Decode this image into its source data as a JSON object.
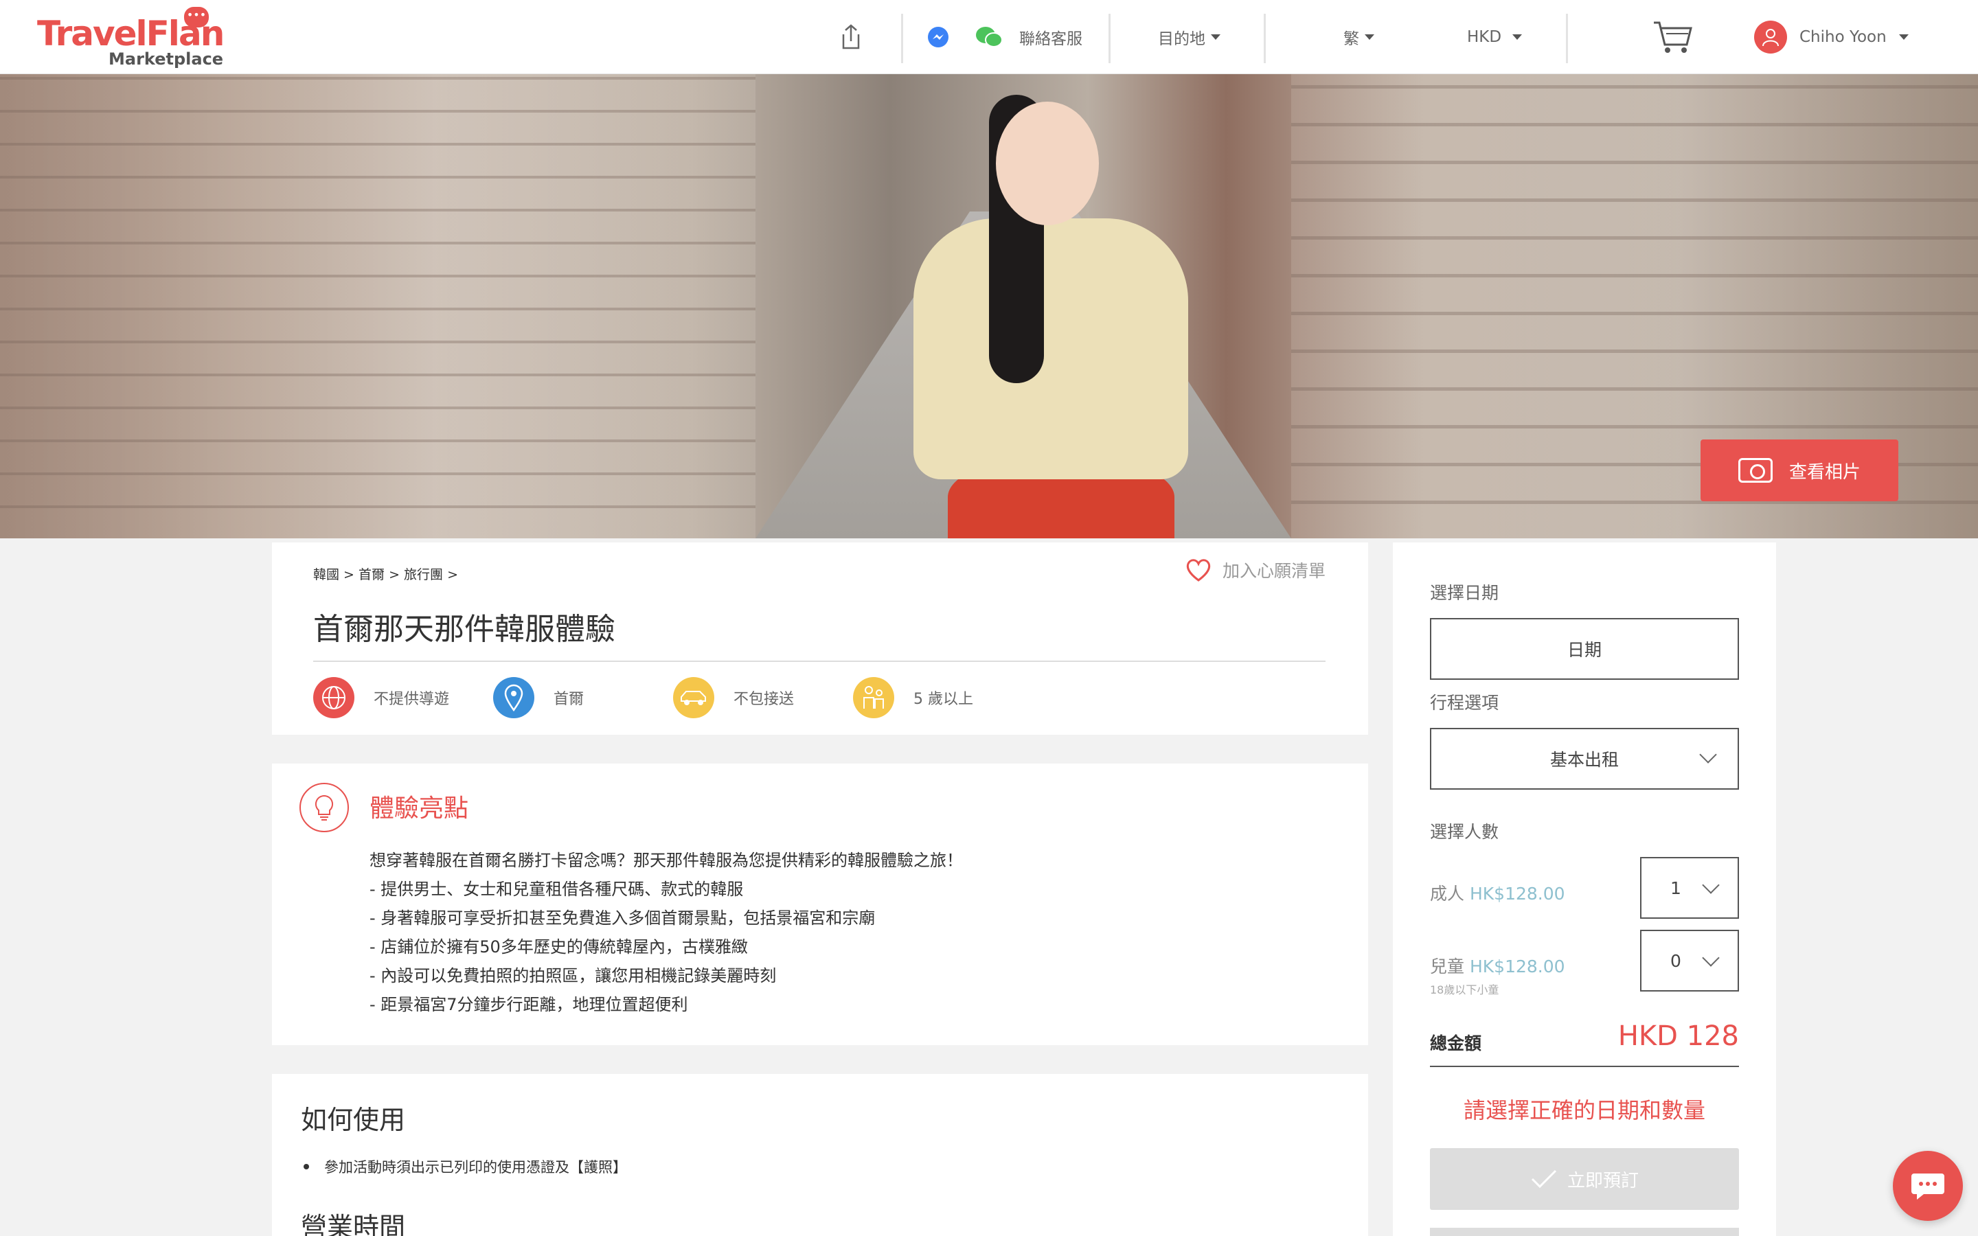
{
  "brand": {
    "name": "TravelFlan",
    "sub": "Marketplace"
  },
  "header": {
    "contact": "聯絡客服",
    "destination": "目的地",
    "language": "繁",
    "currency": "HKD",
    "user": "Chiho Yoon"
  },
  "hero": {
    "photos_button": "查看相片"
  },
  "product": {
    "breadcrumb": [
      "韓國",
      "首爾",
      "旅行團"
    ],
    "wishlist": "加入心願清單",
    "title": "首爾那天那件韓服體驗",
    "features": [
      {
        "icon": "globe-icon",
        "label": "不提供導遊",
        "color": "#e8524f"
      },
      {
        "icon": "location-pin-icon",
        "label": "首爾",
        "color": "#3a8fd9"
      },
      {
        "icon": "car-icon",
        "label": "不包接送",
        "color": "#f5c64a"
      },
      {
        "icon": "people-icon",
        "label": "5 歲以上",
        "color": "#f5c64a"
      }
    ]
  },
  "highlights": {
    "title": "體驗亮點",
    "lines": [
      "想穿著韓服在首爾名勝打卡留念嗎？那天那件韓服為您提供精彩的韓服體驗之旅！",
      "- 提供男士、女士和兒童租借各種尺碼、款式的韓服",
      "- 身著韓服可享受折扣甚至免費進入多個首爾景點，包括景福宮和宗廟",
      "- 店鋪位於擁有50多年歷史的傳統韓屋內，古樸雅緻",
      "- 內設可以免費拍照的拍照區，讓您用相機記錄美麗時刻",
      "- 距景福宮7分鐘步行距離，地理位置超便利"
    ]
  },
  "usage": {
    "title": "如何使用",
    "items": [
      "參加活動時須出示已列印的使用憑證及【護照】"
    ],
    "hours_title": "營業時間"
  },
  "booking": {
    "date_label": "選擇日期",
    "date_placeholder": "日期",
    "option_label": "行程選項",
    "option_value": "基本出租",
    "people_label": "選擇人數",
    "adult_label": "成人",
    "adult_price": "HK$128.00",
    "adult_qty": "1",
    "child_label": "兒童",
    "child_price": "HK$128.00",
    "child_note": "18歲以下小童",
    "child_qty": "0",
    "total_label": "總金額",
    "total_value": "HKD 128",
    "warning": "請選擇正確的日期和數量",
    "book_button": "立即預訂"
  },
  "colors": {
    "accent": "#e8524f",
    "price": "#8ec0cf"
  }
}
